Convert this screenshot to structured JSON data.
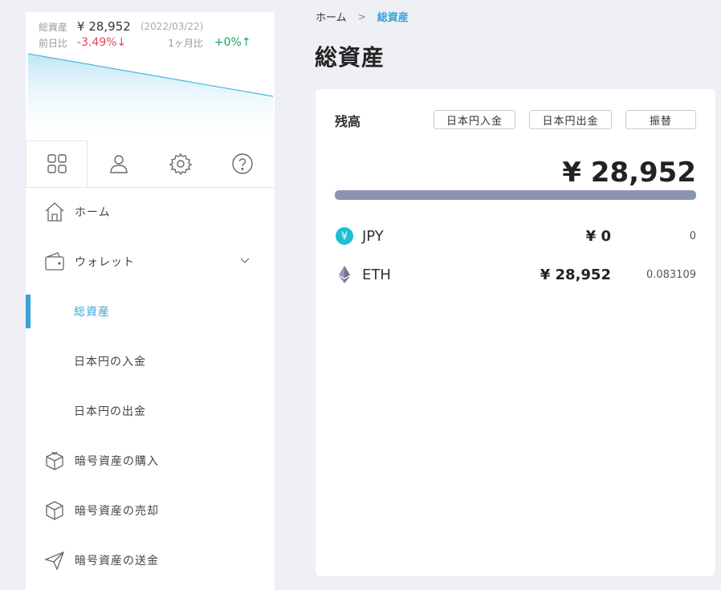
{
  "summary": {
    "total_label": "総資産",
    "total_value": "¥ 28,952",
    "date": "(2022/03/22)",
    "day_label": "前日比",
    "day_change": "-3.49%↓",
    "month_label": "1ヶ月比",
    "month_change": "+0%↑"
  },
  "tabs": [
    {
      "icon": "grid-icon"
    },
    {
      "icon": "user-icon"
    },
    {
      "icon": "gear-icon"
    },
    {
      "icon": "help-icon"
    }
  ],
  "nav": {
    "home": "ホーム",
    "wallet": "ウォレット",
    "total_assets": "総資産",
    "jpy_deposit": "日本円の入金",
    "jpy_withdraw": "日本円の出金",
    "crypto_buy": "暗号資産の購入",
    "crypto_sell": "暗号資産の売却",
    "crypto_send": "暗号資産の送金"
  },
  "breadcrumb": {
    "home": "ホーム",
    "sep": ">",
    "current": "総資産"
  },
  "page_title": "総資産",
  "card": {
    "balance_label": "残高",
    "buttons": {
      "deposit": "日本円入金",
      "withdraw": "日本円出金",
      "transfer": "振替"
    },
    "total": "¥ 28,952",
    "assets": [
      {
        "symbol": "JPY",
        "yen": "¥ 0",
        "amount": "0"
      },
      {
        "symbol": "ETH",
        "yen": "¥ 28,952",
        "amount": "0.083109"
      }
    ]
  },
  "colors": {
    "accent": "#3aa3d8",
    "negative": "#e0485a",
    "positive": "#1ca55a",
    "bar": "#8d94b0",
    "jpy_icon": "#1fbfd3"
  }
}
